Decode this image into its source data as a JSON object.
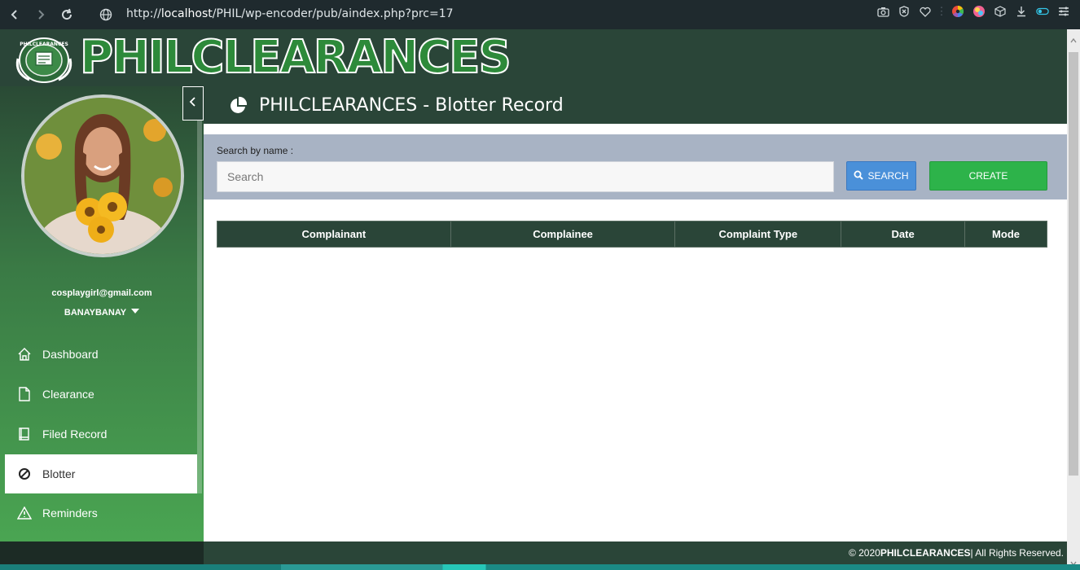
{
  "browser": {
    "url_prefix": "http://",
    "url_host": "localhost",
    "url_path": "/PHIL/wp-encoder/pub/aindex.php?prc=17"
  },
  "brand": {
    "logo_text": "PHILCLEARANCES",
    "seal_text": "PHILCLEARANCES"
  },
  "user": {
    "email": "cosplaygirl@gmail.com",
    "location": "BANAYBANAY"
  },
  "sidebar": {
    "items": [
      {
        "label": "Dashboard",
        "icon": "home-icon",
        "active": false
      },
      {
        "label": "Clearance",
        "icon": "document-icon",
        "active": false
      },
      {
        "label": "Filed Record",
        "icon": "book-icon",
        "active": false
      },
      {
        "label": "Blotter",
        "icon": "ban-icon",
        "active": true
      },
      {
        "label": "Reminders",
        "icon": "warning-icon",
        "active": false
      }
    ]
  },
  "page": {
    "title": "PHILCLEARANCES - Blotter Record",
    "title_icon": "pie-chart-icon"
  },
  "search": {
    "label": "Search by name :",
    "placeholder": "Search",
    "value": "",
    "search_button": "SEARCH",
    "create_button": "CREATE"
  },
  "table": {
    "columns": [
      "Complainant",
      "Complainee",
      "Complaint Type",
      "Date",
      "Mode"
    ],
    "rows": []
  },
  "footer": {
    "copyright": "© 2020 ",
    "brand": "PHILCLEARANCES",
    "rights": " | All Rights Reserved."
  },
  "colors": {
    "header_green": "#2a4538",
    "sidebar_green": "#4aa552",
    "search_blue": "#4a90d9",
    "create_green": "#2db34a",
    "search_panel": "#a8b3c4"
  }
}
